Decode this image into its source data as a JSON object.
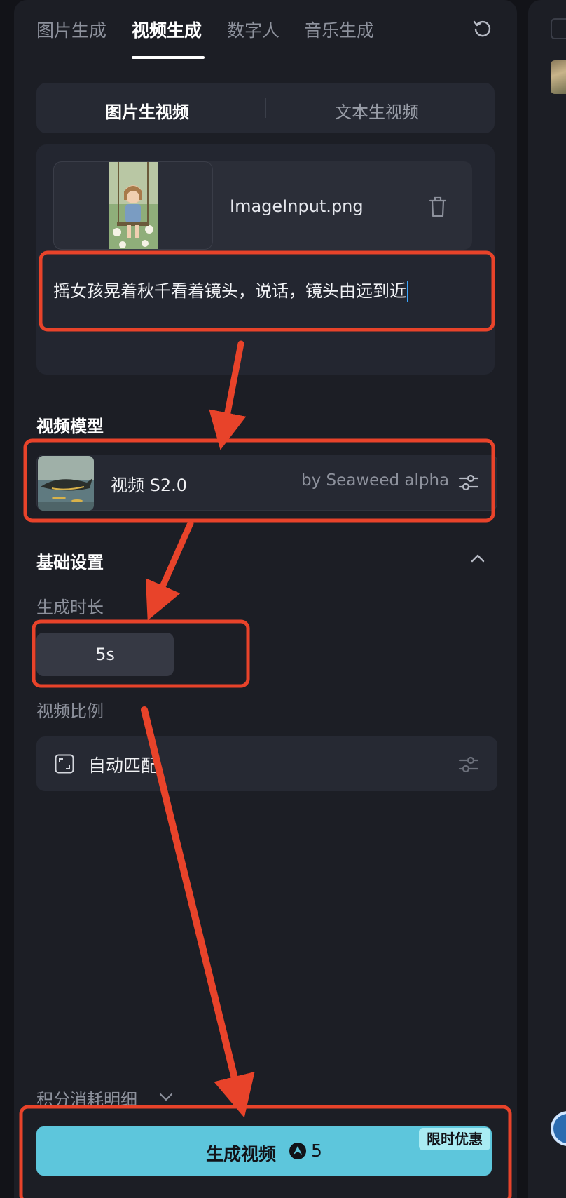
{
  "tabs": [
    {
      "label": "图片生成",
      "active": false
    },
    {
      "label": "视频生成",
      "active": true
    },
    {
      "label": "数字人",
      "active": false
    },
    {
      "label": "音乐生成",
      "active": false
    }
  ],
  "header_icons": {
    "reset": "refresh-icon"
  },
  "segment": {
    "image_to_video": "图片生视频",
    "text_to_video": "文本生视频",
    "active": "image_to_video"
  },
  "upload": {
    "file_name": "ImageInput.png",
    "delete_icon": "trash-icon"
  },
  "prompt": {
    "value": "摇女孩晃着秋千看着镜头，说话，镜头由远到近"
  },
  "video_model": {
    "section_title": "视频模型",
    "name": "视频 S2.0",
    "by": "by Seaweed alpha",
    "settings_icon": "sliders-icon"
  },
  "basic_settings": {
    "section_title": "基础设置",
    "collapse_icon": "chevron-up-icon",
    "duration_label": "生成时长",
    "duration_value": "5s",
    "ratio_label": "视频比例",
    "ratio_value": "自动匹配",
    "ratio_icon": "aspect-ratio-icon",
    "ratio_settings_icon": "sliders-icon"
  },
  "footer": {
    "points_detail": "积分消耗明细",
    "generate_label": "生成视频",
    "credit_cost": "5",
    "credit_icon": "credit-icon",
    "promo_badge": "限时优惠"
  },
  "colors": {
    "background": "#1c1e25",
    "card": "#262933",
    "accent_button": "#5dc6dc",
    "annotation_red": "#e8432a",
    "promo_badge": "#a9ecf3"
  }
}
